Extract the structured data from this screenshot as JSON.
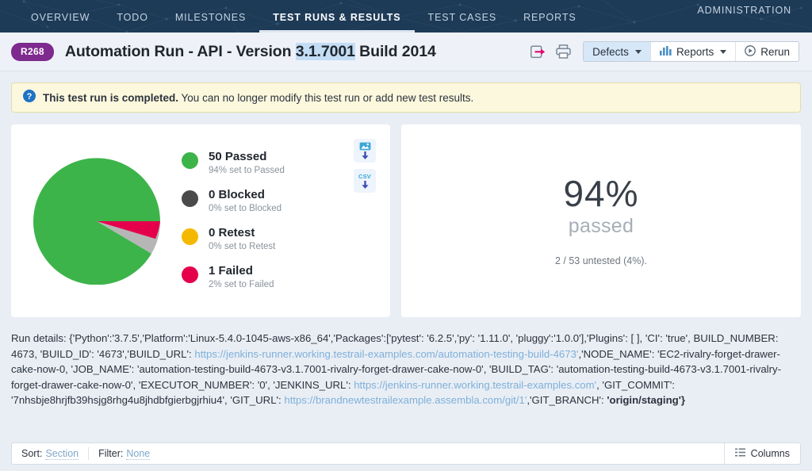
{
  "nav": {
    "items": [
      {
        "label": "OVERVIEW",
        "active": false
      },
      {
        "label": "TODO",
        "active": false
      },
      {
        "label": "MILESTONES",
        "active": false
      },
      {
        "label": "TEST RUNS & RESULTS",
        "active": true
      },
      {
        "label": "TEST CASES",
        "active": false
      },
      {
        "label": "REPORTS",
        "active": false
      }
    ],
    "admin_label": "ADMINISTRATION",
    "background_color": "#1d3a57"
  },
  "header": {
    "badge": "R268",
    "title_before": "Automation Run - API - Version ",
    "title_selected": "3.1.7001",
    "title_after": " Build 2014",
    "badge_color": "#7e2a8e",
    "export_icon": "export-icon",
    "print_icon": "print-icon",
    "buttons": [
      {
        "label": "Defects",
        "icon": "",
        "caret": true,
        "selected": true
      },
      {
        "label": "Reports",
        "icon": "bar-chart-icon",
        "caret": true,
        "selected": false
      },
      {
        "label": "Rerun",
        "icon": "play-circle-icon",
        "caret": false,
        "selected": false
      }
    ]
  },
  "notice": {
    "icon": "help-circle-icon",
    "bold_text": "This test run is completed.",
    "text": " You can no longer modify this test run or add new test results."
  },
  "chart_data": {
    "type": "pie",
    "title": "",
    "categories": [
      "Passed",
      "Untested",
      "Failed"
    ],
    "values": [
      50,
      2,
      1
    ],
    "percentages": [
      94,
      4,
      2
    ],
    "colors": [
      "#3cb44a",
      "#b6b6b6",
      "#e5004c"
    ],
    "legend_position": "right",
    "total": 53
  },
  "legend": [
    {
      "count_label": "50 Passed",
      "sub": "94% set to Passed",
      "color": "#3cb44a",
      "name": "passed"
    },
    {
      "count_label": "0 Blocked",
      "sub": "0% set to Blocked",
      "color": "#4a4a4a",
      "name": "blocked"
    },
    {
      "count_label": "0 Retest",
      "sub": "0% set to Retest",
      "color": "#f5b800",
      "name": "retest"
    },
    {
      "count_label": "1 Failed",
      "sub": "2% set to Failed",
      "color": "#e5004c",
      "name": "failed"
    }
  ],
  "downloads": [
    {
      "name": "download-image-button",
      "label": "image"
    },
    {
      "name": "download-csv-button",
      "label": "CSV"
    }
  ],
  "summary": {
    "percent": "94%",
    "word": "passed",
    "sub": "2 / 53 untested (4%)."
  },
  "run_details": {
    "prefix": "Run details: {'Python':'3.7.5','Platform':'Linux-5.4.0-1045-aws-x86_64','Packages':['pytest': '6.2.5','py': '1.11.0', 'pluggy':'1.0.0'],'Plugins': [ ], 'CI': 'true', BUILD_NUMBER: 4673, 'BUILD_ID': '4673','BUILD_URL': ",
    "build_url": "https://jenkins-runner.working.testrail-examples.com/automation-testing-build-4673'",
    "mid1": ",'NODE_NAME': 'EC2-rivalry-forget-drawer-cake-now-0, 'JOB_NAME': 'automation-testing-build-4673-v3.1.7001-rivalry-forget-drawer-cake-now-0', 'BUILD_TAG': 'automation-testing-build-4673-v3.1.7001-rivalry-forget-drawer-cake-now-0', 'EXECUTOR_NUMBER': '0', 'JENKINS_URL': ",
    "jenkins_url": "https://jenkins-runner.working.testrail-examples.com'",
    "mid2": ", 'GIT_COMMIT': '7nhsbje8hrjfb39hsjg8rhg4u8jhdbfgierbgjrhiu4', 'GIT_URL': ",
    "git_url": "https://brandnewtestrailexample.assembla.com/git/1'",
    "mid3": ",'GIT_BRANCH': ",
    "suffix": "'origin/staging'}"
  },
  "sortbar": {
    "sort_label": "Sort:",
    "sort_value": "Section",
    "filter_label": "Filter:",
    "filter_value": "None",
    "columns_label": "Columns"
  }
}
